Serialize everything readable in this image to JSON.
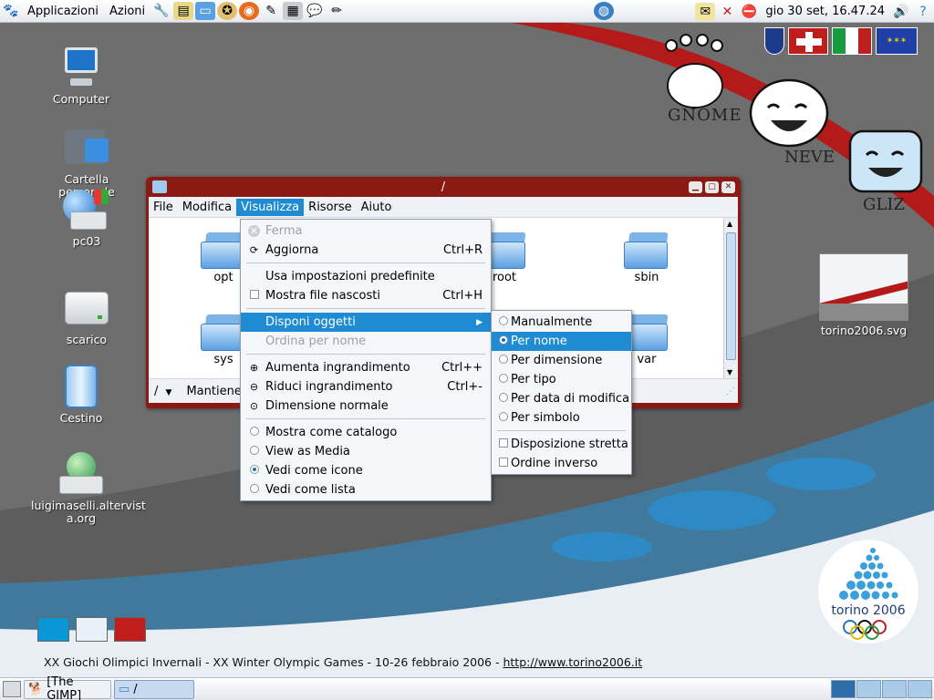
{
  "top_panel": {
    "menus": [
      "Applicazioni",
      "Azioni"
    ],
    "launchers": [
      "tools-icon",
      "notes-icon",
      "desktop-icon",
      "compass-icon",
      "firefox-icon",
      "gimp-icon",
      "calculator-icon",
      "chat-icon",
      "edit-icon"
    ],
    "clock": "gio 30 set, 16.47.24"
  },
  "desktop": {
    "icons": [
      {
        "name": "computer",
        "label": "Computer"
      },
      {
        "name": "home",
        "label": "Cartella personale"
      },
      {
        "name": "pc03",
        "label": "pc03"
      },
      {
        "name": "scarico",
        "label": "scarico"
      },
      {
        "name": "trash",
        "label": "Cestino"
      },
      {
        "name": "site",
        "label": "luigimaselli.altervist a.org"
      },
      {
        "name": "svg-file",
        "label": "torino2006.svg"
      }
    ],
    "branding": {
      "gnome": "GNOME",
      "neve": "NEVE",
      "gliz": "GLIZ",
      "torino_logo": "torino 2006"
    },
    "caption_text": "XX Giochi Olimpici Invernali - XX Winter Olympic Games - 10-26 febbraio 2006 - ",
    "caption_link": "http://www.torino2006.it",
    "swatch_colors": [
      "#0a97d8",
      "#e8f1f8",
      "#c01d1d"
    ]
  },
  "window": {
    "title": "/",
    "menubar": [
      "File",
      "Modifica",
      "Visualizza",
      "Risorse",
      "Aiuto"
    ],
    "folders": [
      "opt",
      "root",
      "sbin",
      "sys",
      "var"
    ],
    "status_path": "/",
    "status_text": "Mantiene"
  },
  "view_menu": {
    "items": [
      {
        "label": "Ferma",
        "icon": "stop-icon",
        "disabled": true
      },
      {
        "label": "Aggiorna",
        "accel": "Ctrl+R",
        "icon": "reload-icon"
      },
      {
        "label": "Usa impostazioni predefinite"
      },
      {
        "label": "Mostra file nascosti",
        "accel": "Ctrl+H",
        "check": false
      },
      {
        "label": "Disponi oggetti",
        "submenu": true
      },
      {
        "label": "Ordina per nome",
        "disabled": true
      },
      {
        "label": "Aumenta ingrandimento",
        "accel": "Ctrl++",
        "icon": "zoom-in-icon"
      },
      {
        "label": "Riduci ingrandimento",
        "accel": "Ctrl+-",
        "icon": "zoom-out-icon"
      },
      {
        "label": "Dimensione normale",
        "icon": "zoom-normal-icon"
      },
      {
        "label": "Mostra come catalogo",
        "radio": false
      },
      {
        "label": "View as Media",
        "radio": false
      },
      {
        "label": "Vedi come icone",
        "radio": true
      },
      {
        "label": "Vedi come lista",
        "radio": false
      }
    ]
  },
  "arrange_menu": {
    "items": [
      {
        "label": "Manualmente",
        "radio": false
      },
      {
        "label": "Per nome",
        "radio": true
      },
      {
        "label": "Per dimensione",
        "radio": false
      },
      {
        "label": "Per tipo",
        "radio": false
      },
      {
        "label": "Per data di modifica",
        "radio": false
      },
      {
        "label": "Per simbolo",
        "radio": false
      },
      {
        "label": "Disposizione stretta",
        "check": false
      },
      {
        "label": "Ordine inverso",
        "check": false
      }
    ]
  },
  "taskbar": {
    "tasks": [
      "[The GIMP]",
      "/"
    ]
  }
}
